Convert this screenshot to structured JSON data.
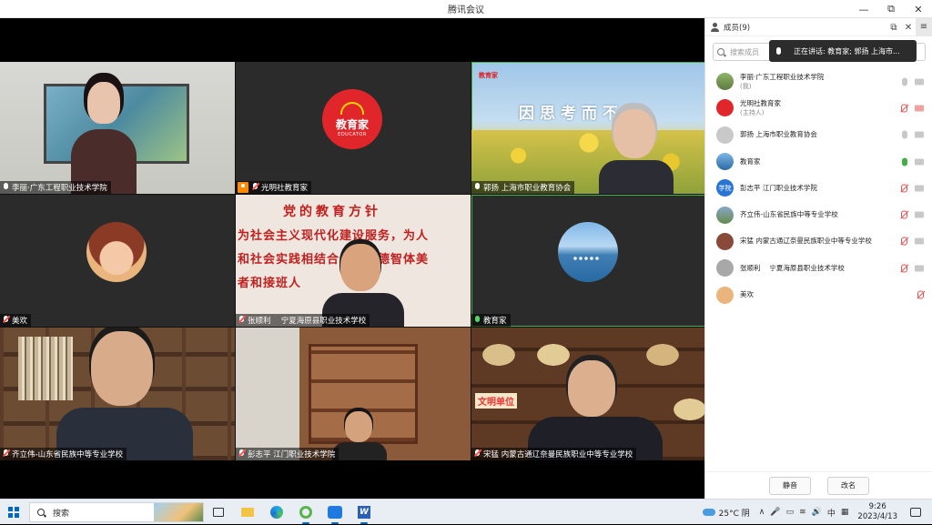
{
  "window": {
    "title": "腾讯会议",
    "controls": [
      "—",
      "⧉",
      "✕"
    ]
  },
  "tiles": [
    {
      "name": "李丽·广东工程职业技术学院",
      "mic": "on"
    },
    {
      "name": "光明社教育家",
      "mic": "muted",
      "host": true,
      "logo_text": "教育家",
      "logo_sub": "EDUCATOR"
    },
    {
      "name": "郭扬 上海市职业教育协会",
      "mic": "on",
      "slogan": "因思考而不同",
      "brand": "教育家"
    },
    {
      "name": "美欢",
      "mic": "muted"
    },
    {
      "name": "张顺利　 宁夏海原县职业技术学校",
      "mic": "muted",
      "wall_lines": [
        "党的教育方针",
        "为社会主义现代化建设服务，为人",
        "和社会实践相结合，培养德智体美",
        "者和接班人"
      ]
    },
    {
      "name": "教育家",
      "mic": "on"
    },
    {
      "name": "齐立伟-山东省民族中等专业学校",
      "mic": "muted"
    },
    {
      "name": "彭志平 江门职业技术学院",
      "mic": "muted"
    },
    {
      "name": "宋猛 内蒙古通辽奈曼民族职业中等专业学校",
      "mic": "muted",
      "sign": "文明单位"
    }
  ],
  "sidebar": {
    "title": "成员(9)",
    "search_placeholder": "搜索成员",
    "speaking": "正在讲话: 教育家; 郭扬 上海市...",
    "members": [
      {
        "name": "李丽·广东工程职业技术学院",
        "sub": "(我)",
        "mic": "idle",
        "cam": "idle"
      },
      {
        "name": "光明社教育家",
        "sub": "(主持人)",
        "mic": "muted",
        "cam": "muted"
      },
      {
        "name": "郭扬 上海市职业教育协会",
        "sub": "",
        "mic": "idle",
        "cam": "idle"
      },
      {
        "name": "教育家",
        "sub": "",
        "mic": "on",
        "cam": "idle"
      },
      {
        "name": "彭志平 江门职业技术学院",
        "sub": "",
        "mic": "muted",
        "cam": "idle",
        "avatar_text": "学院"
      },
      {
        "name": "齐立伟-山东省民族中等专业学校",
        "sub": "",
        "mic": "muted",
        "cam": "idle"
      },
      {
        "name": "宋猛 内蒙古通辽奈曼民族职业中等专业学校",
        "sub": "",
        "mic": "muted",
        "cam": "idle"
      },
      {
        "name": "张顺利　 宁夏海原县职业技术学校",
        "sub": "",
        "mic": "muted",
        "cam": "idle"
      },
      {
        "name": "美欢",
        "sub": "",
        "mic": "muted",
        "cam": "none"
      }
    ],
    "mute_all_label": "静音",
    "rename_label": "改名"
  },
  "taskbar": {
    "search_text": "搜索",
    "weather": "25°C 阴",
    "time": "9:26",
    "date": "2023/4/13",
    "tray_icons": [
      "∧",
      "🎤",
      "▭",
      "≋",
      "🔊",
      "中",
      "▦"
    ]
  }
}
